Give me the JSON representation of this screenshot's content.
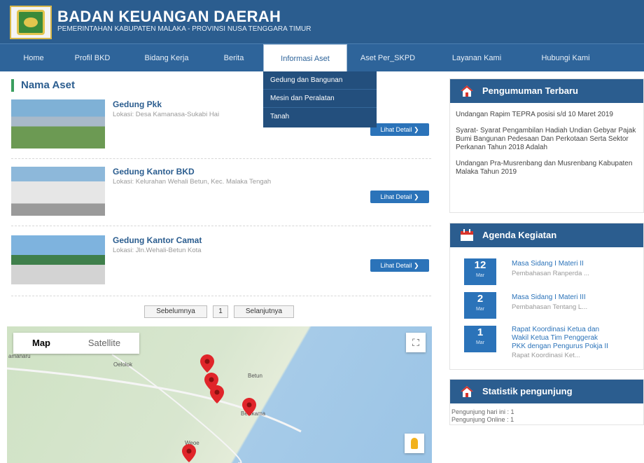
{
  "header": {
    "title": "BADAN KEUANGAN DAERAH",
    "subtitle": "PEMERINTAHAN KABUPATEN MALAKA - PROVINSI NUSA TENGGARA TIMUR"
  },
  "nav": [
    "Home",
    "Profil BKD",
    "Bidang Kerja",
    "Berita",
    "Informasi Aset",
    "Aset Per_SKPD",
    "Layanan Kami",
    "Hubungi Kami"
  ],
  "dropdown": [
    "Gedung dan Bangunan",
    "Mesin dan Peralatan",
    "Tanah"
  ],
  "section_title": "Nama Aset",
  "assets": [
    {
      "name": "Gedung Pkk",
      "location": "Lokasi: Desa Kamanasa-Sukabi Hai",
      "button": "Lihat Detail ❯"
    },
    {
      "name": "Gedung Kantor BKD",
      "location": "Lokasi: Kelurahan Wehali Betun, Kec. Malaka Tengah",
      "button": "Lihat Detail ❯"
    },
    {
      "name": "Gedung Kantor Camat",
      "location": "Lokasi: Jln.Wehali-Betun Kota",
      "button": "Lihat Detail ❯"
    }
  ],
  "pagination": {
    "prev": "Sebelumnya",
    "page": "1",
    "next": "Selanjutnya"
  },
  "map": {
    "tab_map": "Map",
    "tab_satellite": "Satellite",
    "labels": [
      "amanaru",
      "Oelolok",
      "Betun",
      "Besikama",
      "Weoe"
    ]
  },
  "announcements": {
    "title": "Pengumuman Terbaru",
    "items": [
      "Undangan Rapim TEPRA posisi s/d 10 Maret 2019",
      "Syarat- Syarat Pengambilan Hadiah Undian Gebyar Pajak Bumi Bangunan Pedesaan Dan Perkotaan Serta Sektor Perkanan Tahun 2018 Adalah",
      "Undangan Pra-Musrenbang dan Musrenbang Kabupaten Malaka Tahun 2019"
    ]
  },
  "agenda": {
    "title": "Agenda Kegiatan",
    "items": [
      {
        "day": "12",
        "month": "Mar",
        "title": "Masa Sidang I Materi II",
        "sub": "Pembahasan Ranperda ..."
      },
      {
        "day": "2",
        "month": "Mar",
        "title": "Masa Sidang I Materi III",
        "sub": "Pembahasan Tentang L..."
      },
      {
        "day": "1",
        "month": "Mar",
        "title_lines": [
          "Rapat Koordinasi Ketua dan",
          "Wakil Ketua Tim Penggerak",
          "PKK dengan Pengurus Pokja II"
        ],
        "sub": "Rapat Koordinasi Ket..."
      }
    ]
  },
  "stats": {
    "title": "Statistik pengunjung",
    "today": "Pengunjung hari ini : 1",
    "online": "Pengunjung Online : 1"
  }
}
